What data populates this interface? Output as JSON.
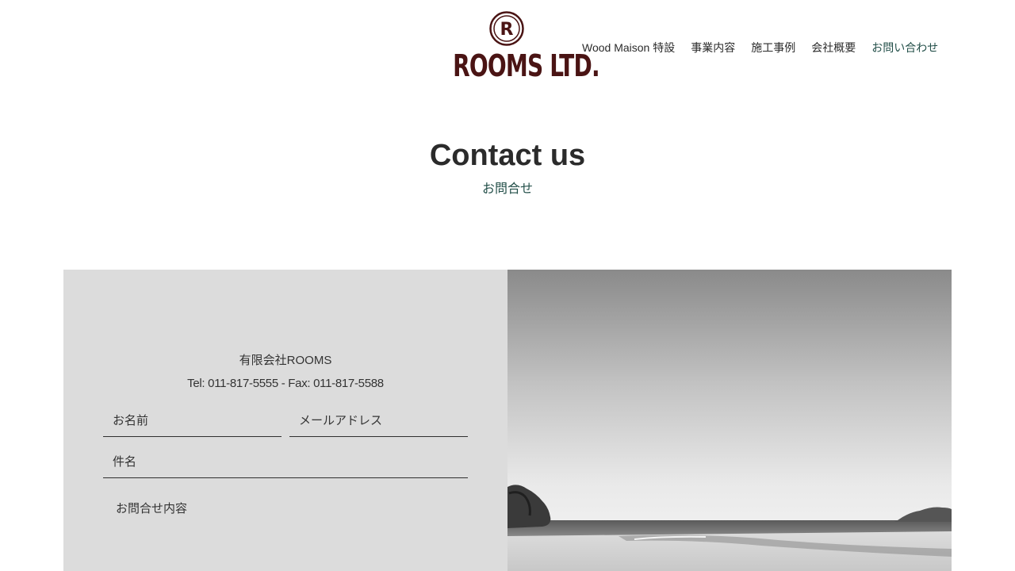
{
  "header": {
    "logo_text": "ROOMS LTD.",
    "logo_mark_letter": "R",
    "brand_color": "#4a1414"
  },
  "nav": {
    "items": [
      {
        "label": "Wood Maison 特設"
      },
      {
        "label": "事業内容"
      },
      {
        "label": "施工事例"
      },
      {
        "label": "会社概要"
      },
      {
        "label": "お問い合わせ",
        "active": true
      }
    ],
    "accent_color": "#24504a"
  },
  "page": {
    "title": "Contact us",
    "subtitle": "お問合せ"
  },
  "contact": {
    "company": "有限会社ROOMS",
    "tel_fax": "Tel: 011-817-5555 - Fax: 011-817-5588",
    "panel_color": "#dcdcdc",
    "form": {
      "name_placeholder": "お名前",
      "email_placeholder": "メールアドレス",
      "subject_placeholder": "件名",
      "message_placeholder": "お問合せ内容"
    }
  },
  "image": {
    "subject": "black-and-white beach landscape"
  }
}
